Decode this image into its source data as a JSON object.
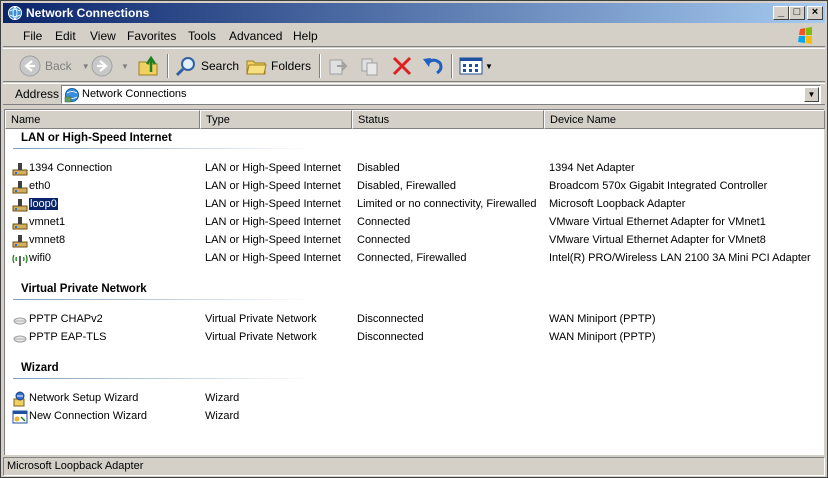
{
  "window": {
    "title": "Network Connections"
  },
  "menu": [
    "File",
    "Edit",
    "View",
    "Favorites",
    "Tools",
    "Advanced",
    "Help"
  ],
  "toolbar": {
    "back_label": "Back",
    "search_label": "Search",
    "folders_label": "Folders"
  },
  "address": {
    "label": "Address",
    "value": "Network Connections"
  },
  "columns": [
    "Name",
    "Type",
    "Status",
    "Device Name"
  ],
  "groups": [
    {
      "title": "LAN or High-Speed Internet",
      "items": [
        {
          "name": "1394 Connection",
          "type": "LAN or High-Speed Internet",
          "status": "Disabled",
          "device": "1394 Net Adapter",
          "icon": "lan-icon"
        },
        {
          "name": "eth0",
          "type": "LAN or High-Speed Internet",
          "status": "Disabled, Firewalled",
          "device": "Broadcom 570x Gigabit Integrated Controller",
          "icon": "lan-icon"
        },
        {
          "name": "loop0",
          "type": "LAN or High-Speed Internet",
          "status": "Limited or no connectivity, Firewalled",
          "device": "Microsoft Loopback Adapter",
          "icon": "lan-icon",
          "selected": true
        },
        {
          "name": "vmnet1",
          "type": "LAN or High-Speed Internet",
          "status": "Connected",
          "device": "VMware Virtual Ethernet Adapter for VMnet1",
          "icon": "lan-icon"
        },
        {
          "name": "vmnet8",
          "type": "LAN or High-Speed Internet",
          "status": "Connected",
          "device": "VMware Virtual Ethernet Adapter for VMnet8",
          "icon": "lan-icon"
        },
        {
          "name": "wifi0",
          "type": "LAN or High-Speed Internet",
          "status": "Connected, Firewalled",
          "device": "Intel(R) PRO/Wireless LAN 2100 3A Mini PCI Adapter",
          "icon": "wireless-icon"
        }
      ]
    },
    {
      "title": "Virtual Private Network",
      "items": [
        {
          "name": "PPTP CHAPv2",
          "type": "Virtual Private Network",
          "status": "Disconnected",
          "device": "WAN Miniport (PPTP)",
          "icon": "vpn-icon"
        },
        {
          "name": "PPTP EAP-TLS",
          "type": "Virtual Private Network",
          "status": "Disconnected",
          "device": "WAN Miniport (PPTP)",
          "icon": "vpn-icon"
        }
      ]
    },
    {
      "title": "Wizard",
      "items": [
        {
          "name": "Network Setup Wizard",
          "type": "Wizard",
          "status": "",
          "device": "",
          "icon": "network-setup-wizard-icon"
        },
        {
          "name": "New Connection Wizard",
          "type": "Wizard",
          "status": "",
          "device": "",
          "icon": "new-connection-wizard-icon"
        }
      ]
    }
  ],
  "statusbar": {
    "text": "Microsoft Loopback Adapter"
  }
}
